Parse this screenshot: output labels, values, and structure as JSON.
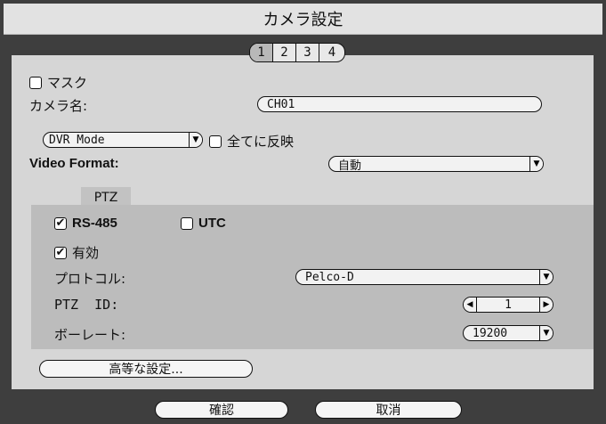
{
  "title": "カメラ設定",
  "tabs": [
    "1",
    "2",
    "3",
    "4"
  ],
  "mask": {
    "label": "マスク",
    "checked": false
  },
  "camera_name": {
    "label": "カメラ名:",
    "value": "CH01"
  },
  "mode": {
    "value": "DVR Mode",
    "apply_all_label": "全てに反映"
  },
  "video_format": {
    "label": "Video Format:",
    "value": "自動"
  },
  "ptz": {
    "tab_label": "PTZ",
    "rs485_label": "RS-485",
    "utc_label": "UTC",
    "enable_label": "有効",
    "protocol_label": "プロトコル:",
    "protocol_value": "Pelco-D",
    "id_label": "PTZ  ID:",
    "id_value": "1",
    "baud_label": "ボーレート:",
    "baud_value": "19200"
  },
  "advanced_label": "高等な設定...",
  "footer": {
    "ok_label": "確認",
    "cancel_label": "取消"
  },
  "checks": {
    "check": "✔",
    "arrow_down": "▼",
    "arrow_left": "◀",
    "arrow_right": "▶"
  }
}
